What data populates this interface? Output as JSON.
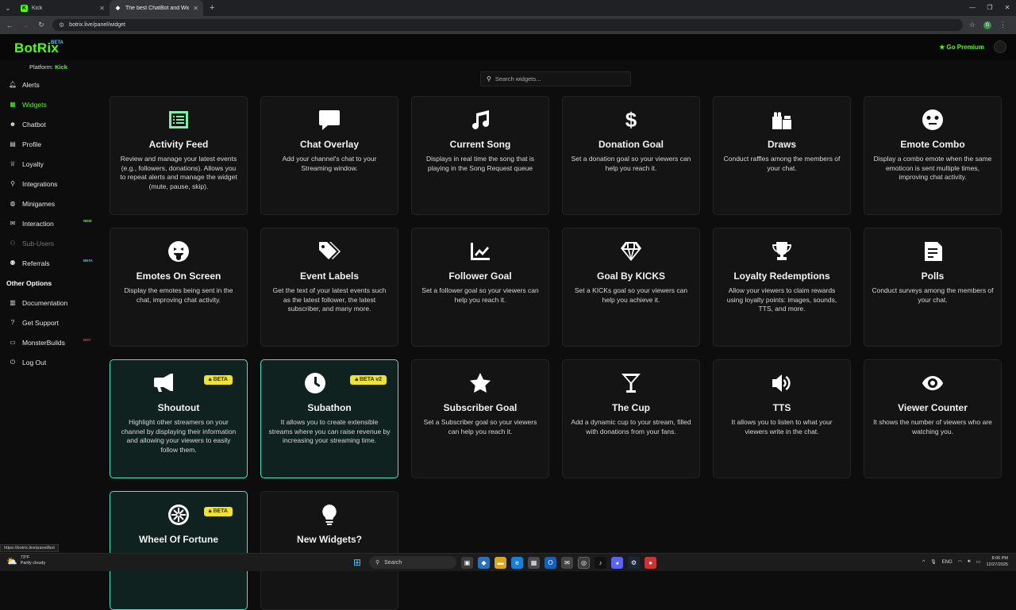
{
  "browser": {
    "tabs": [
      {
        "title": "Kick",
        "favicon_color": "#53fc18",
        "favicon_letter": "K"
      },
      {
        "title": "The best ChatBot and Widgets f",
        "favicon_color": "#ffffff",
        "favicon_letter": "◆"
      }
    ],
    "url": "botrix.live/panel/widget"
  },
  "header": {
    "logo": "BotRix",
    "logo_badge": "BETA",
    "platform_label": "Platform:",
    "platform_value": "Kick",
    "premium_label": "Go Premium"
  },
  "sidebar": {
    "items": [
      {
        "label": "Alerts",
        "icon": "bell-icon"
      },
      {
        "label": "Widgets",
        "icon": "grid-icon",
        "active": true
      },
      {
        "label": "Chatbot",
        "icon": "robot-icon"
      },
      {
        "label": "Profile",
        "icon": "id-card-icon"
      },
      {
        "label": "Loyalty",
        "icon": "trophy-icon"
      },
      {
        "label": "Integrations",
        "icon": "plug-icon"
      },
      {
        "label": "Minigames",
        "icon": "gamepad-icon"
      },
      {
        "label": "Interaction",
        "icon": "comments-icon",
        "badge": "NEW",
        "badge_color": "#53fc18"
      },
      {
        "label": "Sub-Users",
        "icon": "users-icon",
        "disabled": true
      },
      {
        "label": "Referrals",
        "icon": "people-icon",
        "badge": "BETA",
        "badge_color": "#53c6fc"
      }
    ],
    "other_heading": "Other Options",
    "other_items": [
      {
        "label": "Documentation",
        "icon": "book-icon"
      },
      {
        "label": "Get Support",
        "icon": "question-icon"
      },
      {
        "label": "MonsterBuilds",
        "icon": "monitor-icon",
        "badge": "HOT",
        "badge_color": "#ff3b3b"
      },
      {
        "label": "Log Out",
        "icon": "logout-icon"
      }
    ]
  },
  "search": {
    "placeholder": "Search widgets..."
  },
  "widgets": [
    {
      "title": "Activity Feed",
      "desc": "Review and manage your latest events (e.g., followers, donations). Allows you to repeat alerts and manage the widget (mute, pause, skip).",
      "icon": "list-icon"
    },
    {
      "title": "Chat Overlay",
      "desc": "Add your channel's chat to your Streaming window.",
      "icon": "chat-bubble-icon"
    },
    {
      "title": "Current Song",
      "desc": "Displays in real time the song that is playing in the Song Request queue",
      "icon": "music-note-icon"
    },
    {
      "title": "Donation Goal",
      "desc": "Set a donation goal so your viewers can help you reach it.",
      "icon": "dollar-icon"
    },
    {
      "title": "Draws",
      "desc": "Conduct raffles among the members of your chat.",
      "icon": "gifts-icon"
    },
    {
      "title": "Emote Combo",
      "desc": "Display a combo emote when the same emoticon is sent multiple times, improving chat activity.",
      "icon": "face-icon"
    },
    {
      "title": "Emotes On Screen",
      "desc": "Display the emotes being sent in the chat, improving chat activity.",
      "icon": "tongue-face-icon"
    },
    {
      "title": "Event Labels",
      "desc": "Get the text of your latest events such as the latest follower, the latest subscriber, and many more.",
      "icon": "tags-icon"
    },
    {
      "title": "Follower Goal",
      "desc": "Set a follower goal so your viewers can help you reach it.",
      "icon": "chart-line-icon"
    },
    {
      "title": "Goal By KICKS",
      "desc": "Set a KICKs goal so your viewers can help you achieve it.",
      "icon": "gem-icon"
    },
    {
      "title": "Loyalty Redemptions",
      "desc": "Allow your viewers to claim rewards using loyalty points: images, sounds, TTS, and more.",
      "icon": "trophy-icon"
    },
    {
      "title": "Polls",
      "desc": "Conduct surveys among the members of your chat.",
      "icon": "poll-icon"
    },
    {
      "title": "Shoutout",
      "desc": "Highlight other streamers on your channel by displaying their information and allowing your viewers to easily follow them.",
      "icon": "megaphone-icon",
      "badge": "BETA",
      "highlight": true
    },
    {
      "title": "Subathon",
      "desc": "It allows you to create extensible streams where you can raise revenue by increasing your streaming time.",
      "icon": "clock-icon",
      "badge": "BETA v2",
      "highlight": true
    },
    {
      "title": "Subscriber Goal",
      "desc": "Set a Subscriber goal so your viewers can help you reach it.",
      "icon": "star-icon"
    },
    {
      "title": "The Cup",
      "desc": "Add a dynamic cup to your stream, filled with donations from your fans.",
      "icon": "cocktail-icon"
    },
    {
      "title": "TTS",
      "desc": "It allows you to listen to what your viewers write in the chat.",
      "icon": "speaker-icon"
    },
    {
      "title": "Viewer Counter",
      "desc": "It shows the number of viewers who are watching you.",
      "icon": "eye-icon"
    },
    {
      "title": "Wheel Of Fortune",
      "desc": "",
      "icon": "wheel-icon",
      "badge": "BETA",
      "highlight": true
    },
    {
      "title": "New Widgets?",
      "desc": "",
      "icon": "lightbulb-icon"
    }
  ],
  "status_url": "https://botrix.live/panel/bot",
  "taskbar": {
    "weather_temp": "73°F",
    "weather_desc": "Partly cloudy",
    "search_label": "Search",
    "lang": "ENG",
    "time": "8:06 PM",
    "date": "12/27/2025"
  }
}
